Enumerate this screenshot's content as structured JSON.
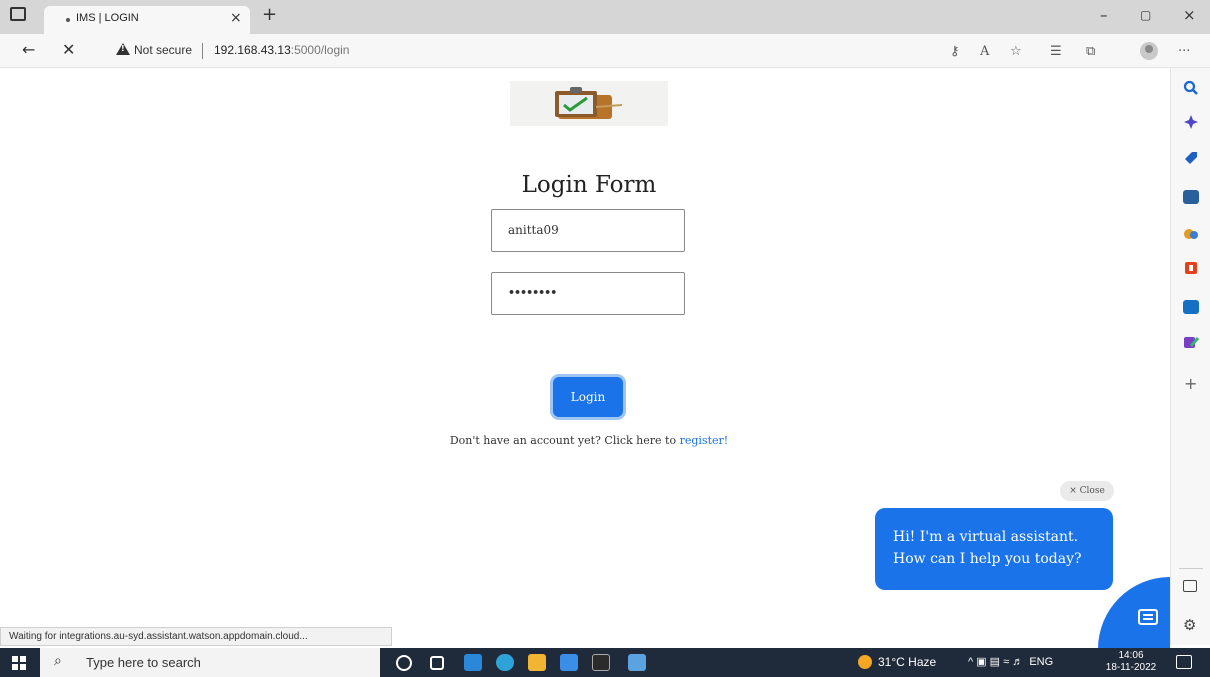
{
  "browser": {
    "tab_title": "IMS | LOGIN",
    "tab_close": "×",
    "new_tab": "+",
    "window_controls": {
      "minimize": "–",
      "restore": "▢",
      "close": "×"
    },
    "address": {
      "security_label": "Not secure",
      "url_host": "192.168.43.13",
      "url_path": ":5000/login"
    },
    "toolbar_icons": [
      "key-icon",
      "read-aloud-icon",
      "favorite-add-icon",
      "favorites-icon",
      "collections-icon",
      "profile-icon",
      "more-icon"
    ],
    "more_label": "···"
  },
  "sidebar": {
    "icons": [
      "search-icon",
      "sparkle-icon",
      "tag-icon",
      "briefcase-icon",
      "games-icon",
      "office-icon",
      "outlook-icon",
      "drop-icon",
      "add-icon"
    ],
    "add_label": "+"
  },
  "page": {
    "title": "Login Form",
    "username_value": "anitta09",
    "password_mask": "••••••••",
    "login_button": "Login",
    "register_prompt": "Don't have an account yet? Click here to ",
    "register_link": "register!"
  },
  "chat": {
    "close_label": "× Close",
    "line1": "Hi! I'm a virtual assistant.",
    "line2": "How can I help you today?",
    "color": "#1a73e8"
  },
  "status_text": "Waiting for integrations.au-syd.assistant.watson.appdomain.cloud...",
  "taskbar": {
    "search_placeholder": "Type here to search",
    "weather": "31°C  Haze",
    "language": "ENG",
    "time": "14:06",
    "date": "18-11-2022"
  }
}
